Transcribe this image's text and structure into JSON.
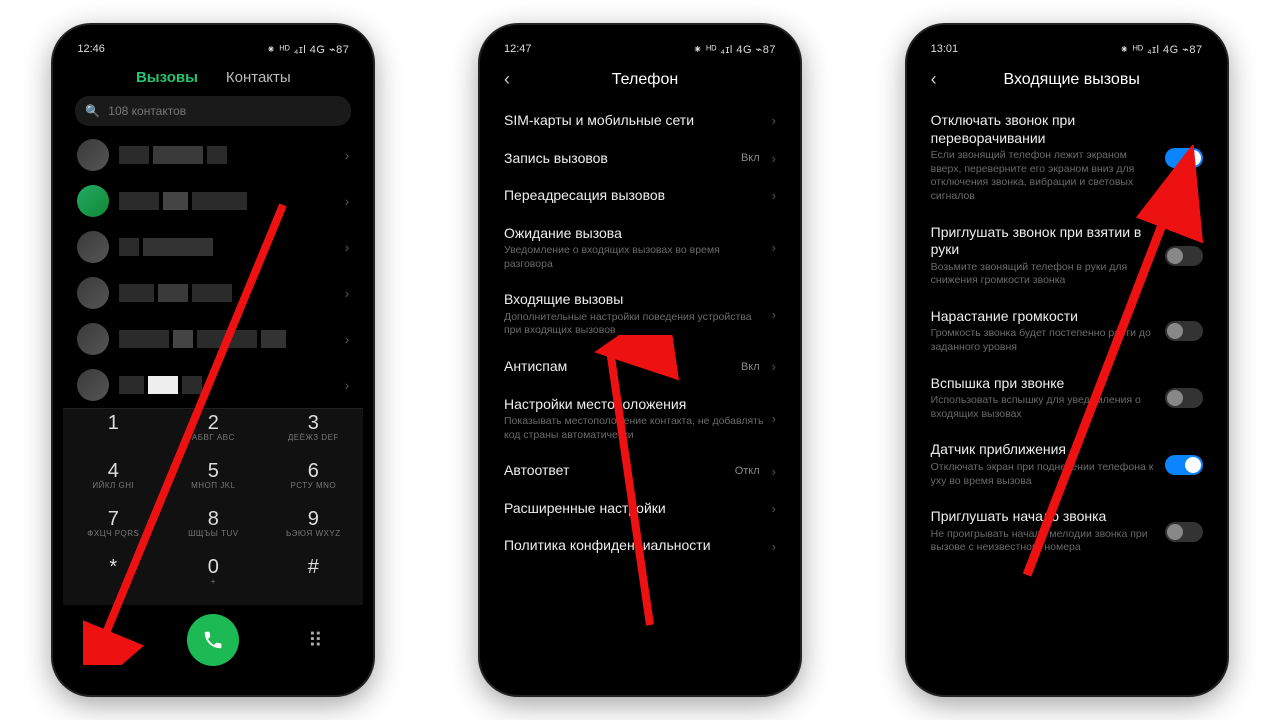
{
  "phone1": {
    "time": "12:46",
    "status_right": "⁕ ᴴᴰ ₄ɪl 4G ⌁87",
    "tabs": {
      "calls": "Вызовы",
      "contacts": "Контакты"
    },
    "search_placeholder": "108 контактов",
    "dialpad": [
      {
        "d": "1",
        "l": ""
      },
      {
        "d": "2",
        "l": "АБВГ ABC"
      },
      {
        "d": "3",
        "l": "ДЕЁЖЗ DEF"
      },
      {
        "d": "4",
        "l": "ИЙКЛ GHI"
      },
      {
        "d": "5",
        "l": "МНОП JKL"
      },
      {
        "d": "6",
        "l": "РСТУ MNO"
      },
      {
        "d": "7",
        "l": "ФХЦЧ PQRS"
      },
      {
        "d": "8",
        "l": "ШЩЪЫ TUV"
      },
      {
        "d": "9",
        "l": "ЬЭЮЯ WXYZ"
      },
      {
        "d": "*",
        "l": ""
      },
      {
        "d": "0",
        "l": "+"
      },
      {
        "d": "#",
        "l": ""
      }
    ]
  },
  "phone2": {
    "time": "12:47",
    "status_right": "⁕ ᴴᴰ ₄ɪl 4G ⌁87",
    "title": "Телефон",
    "items": [
      {
        "label": "SIM-карты и мобильные сети",
        "sub": "",
        "value": "",
        "chev": true
      },
      {
        "label": "Запись вызовов",
        "sub": "",
        "value": "Вкл",
        "chev": true
      },
      {
        "label": "Переадресация вызовов",
        "sub": "",
        "value": "",
        "chev": true
      },
      {
        "label": "Ожидание вызова",
        "sub": "Уведомление о входящих вызовах во время разговора",
        "value": "",
        "chev": true
      },
      {
        "label": "Входящие вызовы",
        "sub": "Дополнительные настройки поведения устройства при входящих вызовов",
        "value": "",
        "chev": true
      },
      {
        "label": "Антиспам",
        "sub": "",
        "value": "Вкл",
        "chev": true
      },
      {
        "label": "Настройки местоположения",
        "sub": "Показывать местоположение контакта, не добавлять код страны автоматически",
        "value": "",
        "chev": true
      },
      {
        "label": "Автоответ",
        "sub": "",
        "value": "Откл",
        "chev": true
      },
      {
        "label": "Расширенные настройки",
        "sub": "",
        "value": "",
        "chev": true
      },
      {
        "label": "Политика конфиденциальности",
        "sub": "",
        "value": "",
        "chev": true
      }
    ]
  },
  "phone3": {
    "time": "13:01",
    "status_right": "⁕ ᴴᴰ ₄ɪl 4G ⌁87",
    "title": "Входящие вызовы",
    "items": [
      {
        "label": "Отключать звонок при переворачивании",
        "sub": "Если звонящий телефон лежит экраном вверх, переверните его экраном вниз для отключения звонка, вибрации и световых сигналов",
        "on": true
      },
      {
        "label": "Приглушать звонок при взятии в руки",
        "sub": "Возьмите звонящий телефон в руки для снижения громкости звонка",
        "on": false
      },
      {
        "label": "Нарастание громкости",
        "sub": "Громкость звонка будет постепенно расти до заданного уровня",
        "on": false
      },
      {
        "label": "Вспышка при звонке",
        "sub": "Использовать вспышку для уведомления о входящих вызовах",
        "on": false
      },
      {
        "label": "Датчик приближения",
        "sub": "Отключать экран при поднесении телефона к уху во время вызова",
        "on": true
      },
      {
        "label": "Приглушать начало звонка",
        "sub": "Не проигрывать начало мелодии звонка при вызове с неизвестного номера",
        "on": false
      }
    ]
  }
}
